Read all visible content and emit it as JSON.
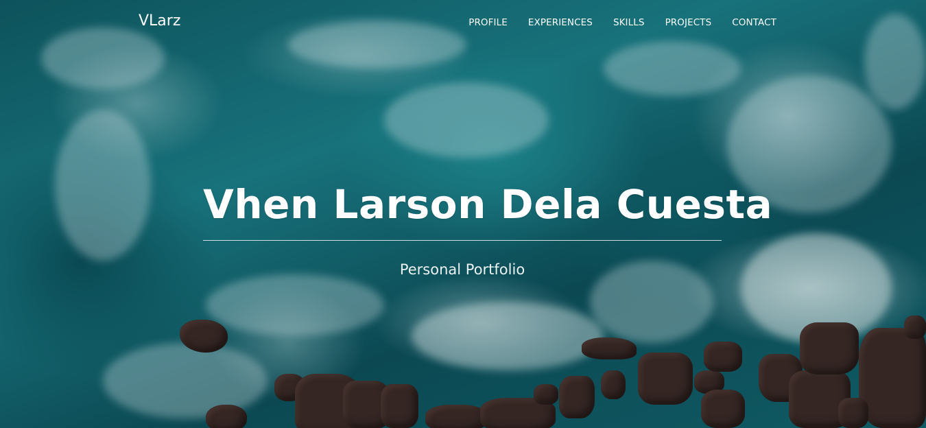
{
  "navbar": {
    "brand": "VLarz",
    "links": [
      {
        "label": "PROFILE"
      },
      {
        "label": "EXPERIENCES"
      },
      {
        "label": "SKILLS"
      },
      {
        "label": "PROJECTS"
      },
      {
        "label": "CONTACT"
      }
    ]
  },
  "hero": {
    "title": "Vhen Larson Dela Cuesta",
    "subtitle": "Personal Portfolio"
  },
  "colors": {
    "text": "#ffffff",
    "ocean_dark": "#0d4f5a",
    "ocean_light": "#1f8c94",
    "rock": "#3a2a27"
  }
}
